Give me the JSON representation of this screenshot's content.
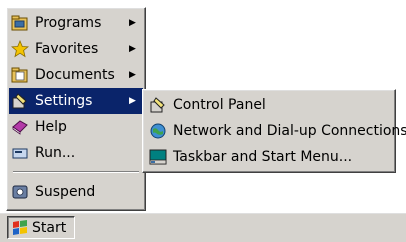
{
  "start_menu": {
    "items": [
      {
        "label": "Programs",
        "icon": "programs-folder-icon",
        "has_submenu": true
      },
      {
        "label": "Favorites",
        "icon": "favorites-star-icon",
        "has_submenu": true
      },
      {
        "label": "Documents",
        "icon": "documents-folder-icon",
        "has_submenu": true
      },
      {
        "label": "Settings",
        "icon": "settings-icon",
        "has_submenu": true,
        "selected": true
      },
      {
        "label": "Help",
        "icon": "help-book-icon"
      },
      {
        "label": "Run...",
        "icon": "run-icon"
      },
      {
        "label": "Suspend",
        "icon": "suspend-icon"
      }
    ]
  },
  "settings_submenu": {
    "items": [
      {
        "label": "Control Panel",
        "icon": "control-panel-icon"
      },
      {
        "label": "Network and Dial-up Connections",
        "icon": "network-globe-icon"
      },
      {
        "label": "Taskbar and Start Menu...",
        "icon": "taskbar-icon"
      }
    ]
  },
  "taskbar": {
    "start_label": "Start",
    "start_icon": "windows-flag-icon"
  },
  "colors": {
    "menu_bg": "#d6d3ce",
    "highlight_bg": "#0a246a",
    "highlight_text": "#ffffff"
  }
}
